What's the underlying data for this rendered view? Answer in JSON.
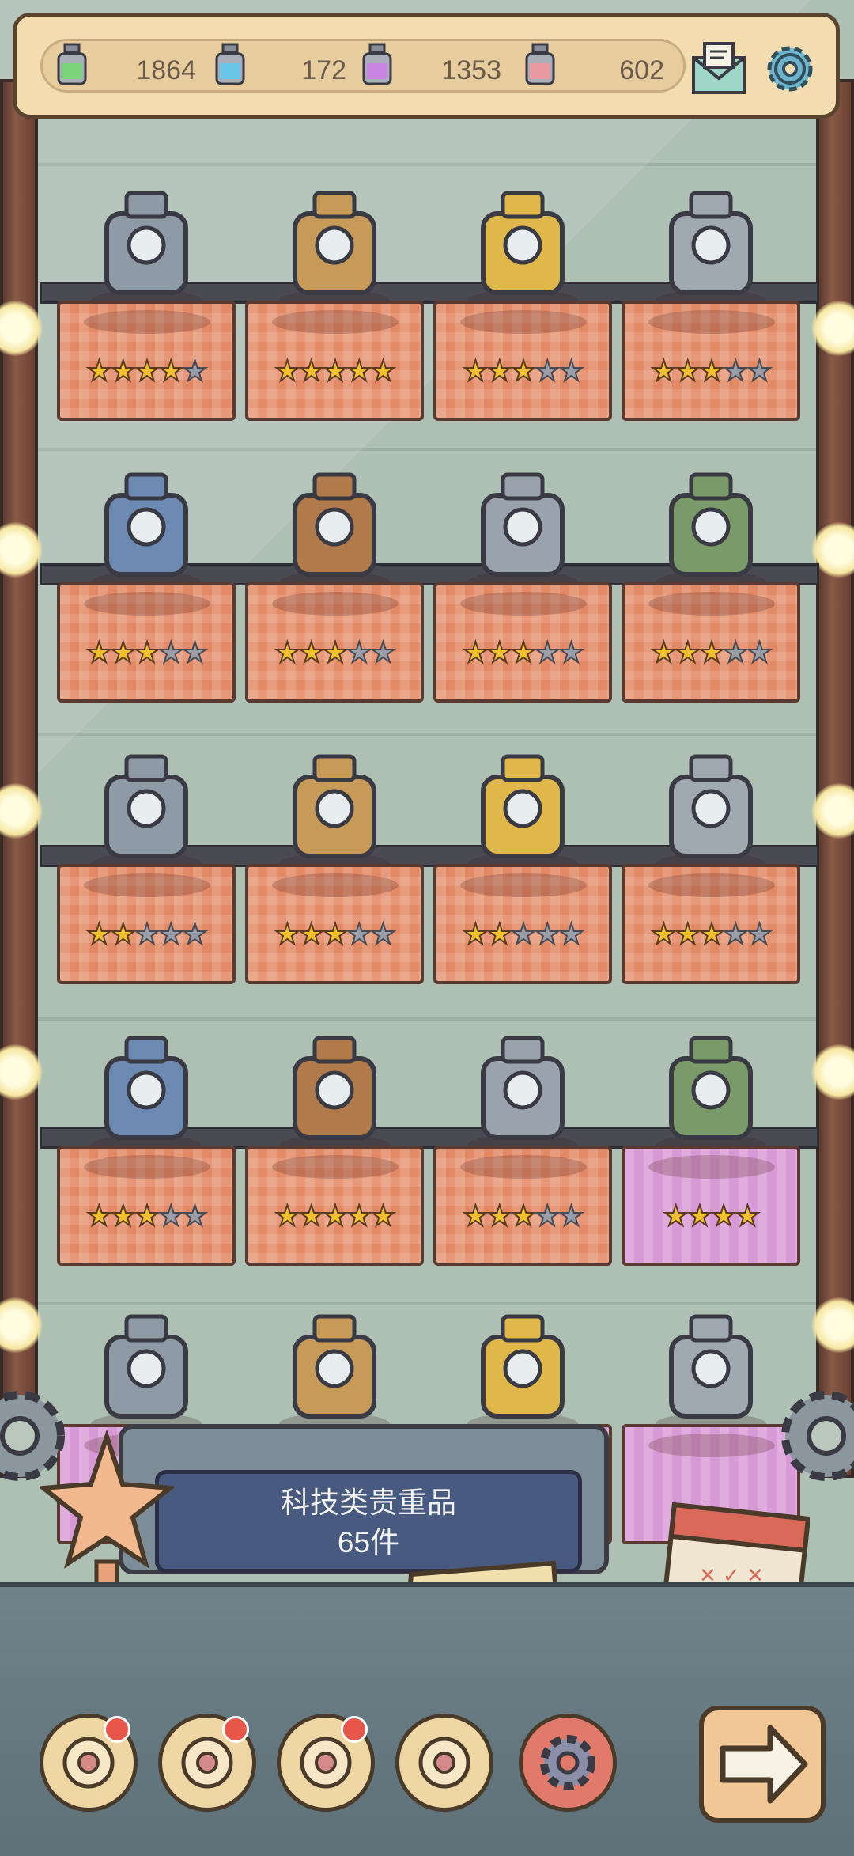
{
  "resources": [
    {
      "name": "green-jar",
      "value": "1864",
      "color": "#7bd47a"
    },
    {
      "name": "blue-jar",
      "value": "172",
      "color": "#6ac6e8"
    },
    {
      "name": "purple-jar",
      "value": "1353",
      "color": "#c884e0"
    },
    {
      "name": "pink-jar",
      "value": "602",
      "color": "#e89aa0"
    }
  ],
  "shelves": [
    [
      {
        "item": "hover-device-icon",
        "stars": 4,
        "cloth": "orange"
      },
      {
        "item": "robot-icon",
        "stars": 5,
        "cloth": "orange"
      },
      {
        "item": "gold-crystal-icon",
        "stars": 3,
        "cloth": "orange"
      },
      {
        "item": "mech-suit-icon",
        "stars": 3,
        "cloth": "orange"
      }
    ],
    [
      {
        "item": "space-telescope-icon",
        "stars": 3,
        "cloth": "orange"
      },
      {
        "item": "film-projector-icon",
        "stars": 3,
        "cloth": "orange"
      },
      {
        "item": "lab-apparatus-icon",
        "stars": 3,
        "cloth": "orange"
      },
      {
        "item": "radioactive-canister-icon",
        "stars": 3,
        "cloth": "orange"
      }
    ],
    [
      {
        "item": "ringed-planet-device-icon",
        "stars": 2,
        "cloth": "orange"
      },
      {
        "item": "photo-book-icon",
        "stars": 3,
        "cloth": "orange"
      },
      {
        "item": "mechanical-eye-icon",
        "stars": 2,
        "cloth": "orange"
      },
      {
        "item": "blueprint-papers-icon",
        "stars": 3,
        "cloth": "orange"
      }
    ],
    [
      {
        "item": "armillary-sphere-icon",
        "stars": 3,
        "cloth": "orange"
      },
      {
        "item": "brain-icon",
        "stars": 5,
        "cloth": "orange"
      },
      {
        "item": "rubiks-cube-icon",
        "stars": 3,
        "cloth": "orange"
      },
      {
        "item": "golden-tower-icon",
        "stars": 4,
        "cloth": "pink"
      }
    ],
    [
      {
        "item": "sheep-icon",
        "stars": 0,
        "cloth": "pink"
      },
      {
        "item": "chinese-book-icon",
        "stars": 0,
        "cloth": "pink"
      },
      {
        "item": "crystal-rock-icon",
        "stars": 0,
        "cloth": "pink"
      },
      {
        "item": "cash-register-icon",
        "stars": 0,
        "cloth": "pink"
      }
    ]
  ],
  "panel": {
    "title": "科技类贵重品",
    "count": "65件"
  },
  "bottom_buttons": [
    {
      "name": "trophy-cup-icon",
      "badge": true
    },
    {
      "name": "rose-icon",
      "badge": true
    },
    {
      "name": "satellite-icon",
      "badge": true
    },
    {
      "name": "quill-icon",
      "badge": false
    },
    {
      "name": "gear-icon",
      "badge": false
    }
  ]
}
